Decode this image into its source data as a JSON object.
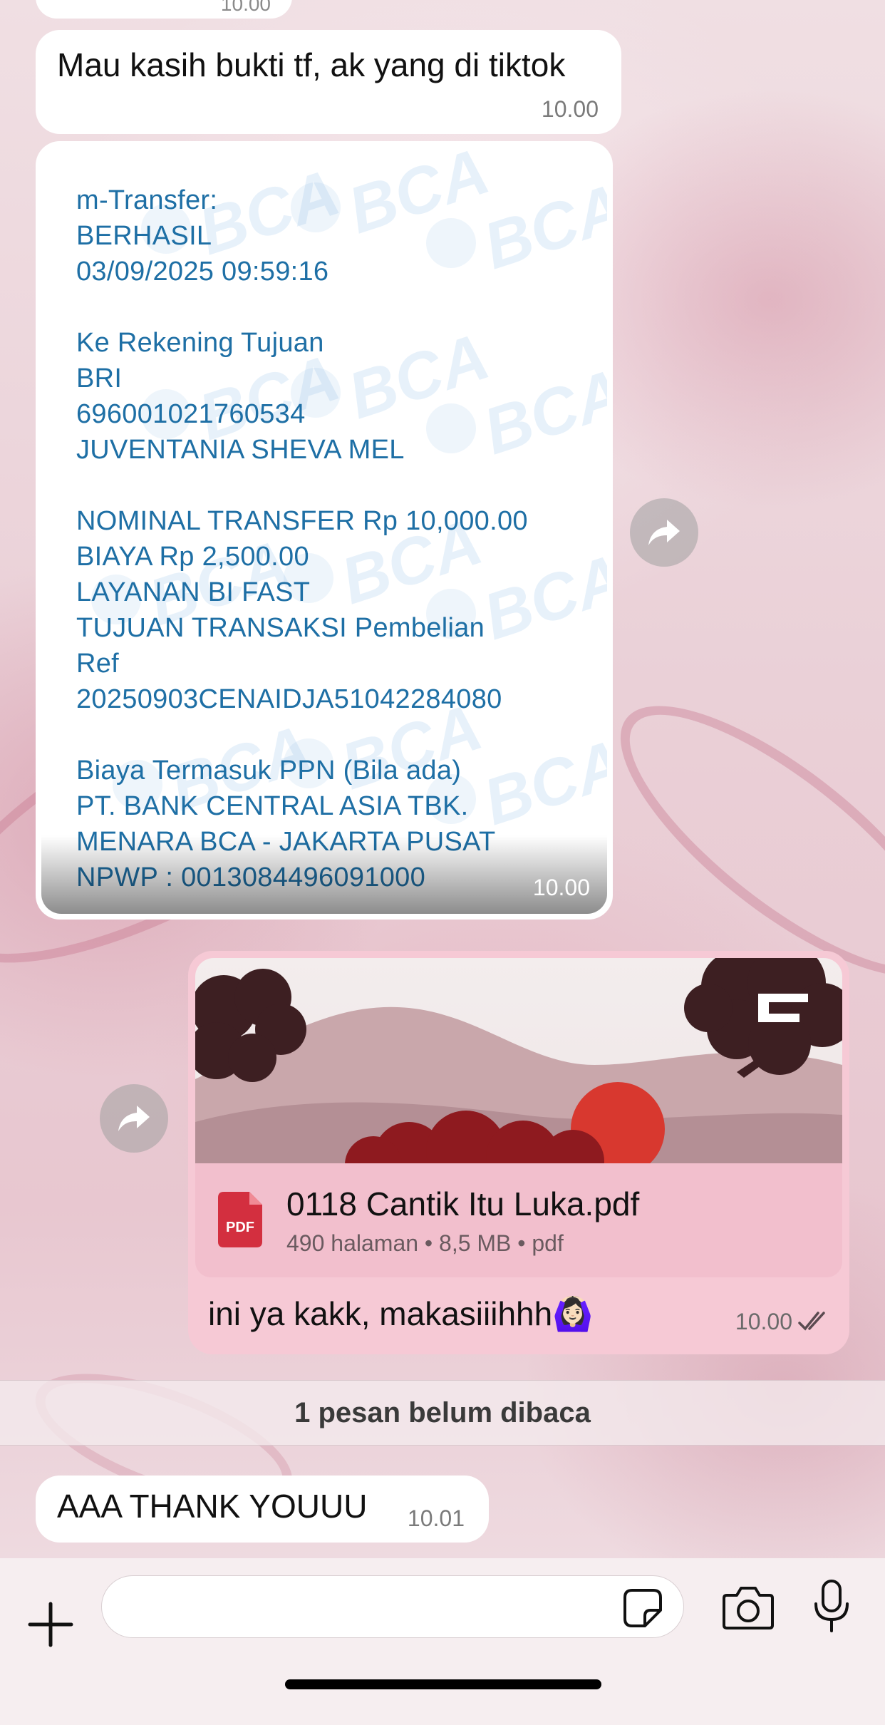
{
  "chat": {
    "prev_time": "10.00",
    "msg1": {
      "text": "Mau kasih bukti tf, ak yang di tiktok",
      "time": "10.00"
    },
    "receipt": {
      "watermark": "BCA",
      "lines": [
        "m-Transfer:",
        "BERHASIL",
        "03/09/2025 09:59:16",
        "",
        "Ke Rekening Tujuan",
        "BRI",
        "696001021760534",
        "JUVENTANIA SHEVA MEL",
        "",
        "NOMINAL TRANSFER Rp 10,000.00",
        "BIAYA Rp 2,500.00",
        "LAYANAN BI FAST",
        "TUJUAN TRANSAKSI Pembelian",
        "Ref",
        "20250903CENAIDJA51042284080",
        "",
        "Biaya Termasuk PPN (Bila ada)",
        "PT. BANK CENTRAL ASIA TBK.",
        "MENARA BCA - JAKARTA PUSAT",
        "NPWP : 0013084496091000"
      ],
      "time": "10.00"
    },
    "pdf_message": {
      "file_name": "0118 Cantik Itu Luka.pdf",
      "meta": "490 halaman • 8,5 MB • pdf",
      "icon_label": "PDF",
      "caption": "ini ya kakk, makasiiihhh🙆🏻‍♀️",
      "time": "10.00"
    },
    "unread_divider": "1 pesan belum dibaca",
    "msg3": {
      "text": "AAA THANK YOUUU",
      "time": "10.01"
    }
  },
  "colors": {
    "incoming_bubble": "#ffffff",
    "outgoing_bubble": "#f6c9d5",
    "receipt_text": "#1e6fa5",
    "pdf_red": "#d32f3f"
  },
  "icons": {
    "forward": "forward-icon",
    "attach": "plus-icon",
    "sticker": "sticker-icon",
    "camera": "camera-icon",
    "mic": "microphone-icon",
    "read": "double-check-icon"
  }
}
